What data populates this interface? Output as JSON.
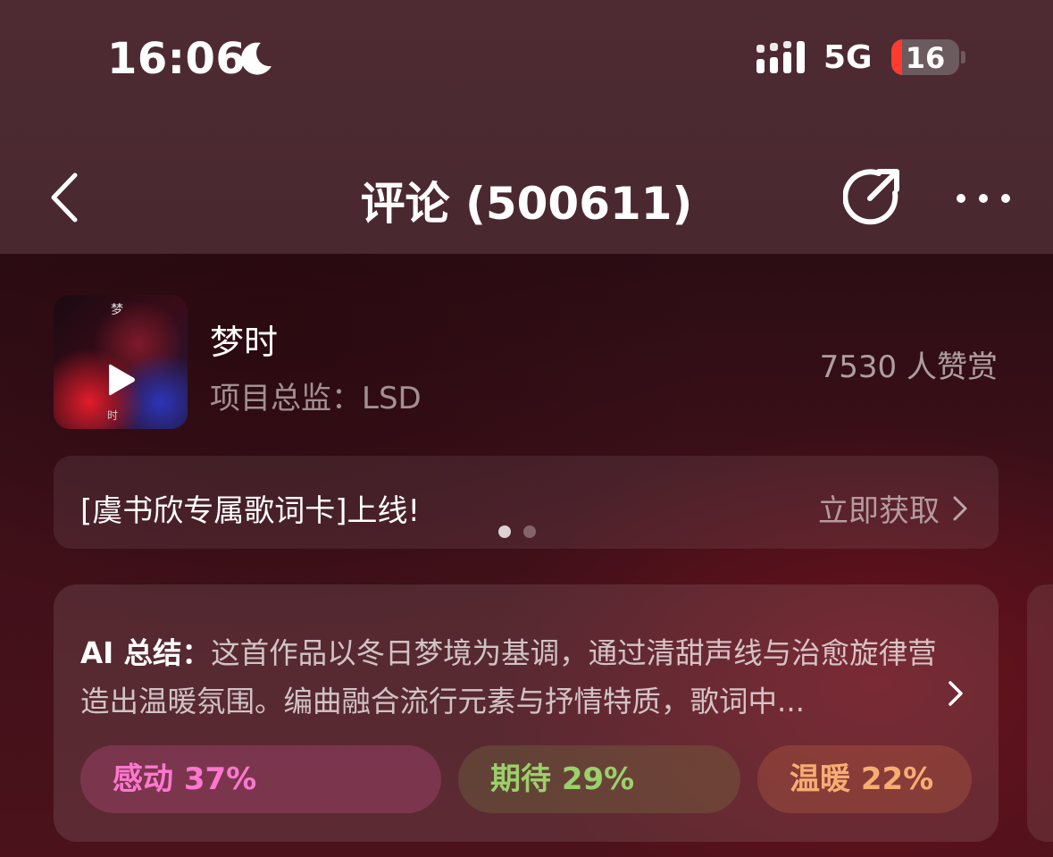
{
  "status_bar": {
    "time": "16:06",
    "network": "5G",
    "battery_level": "16",
    "battery_fraction": 0.16
  },
  "nav": {
    "title": "评论 (500611)",
    "icons": [
      "chevron-left-icon",
      "share-icon",
      "more-icon"
    ]
  },
  "song": {
    "title": "梦时",
    "subtitle": "项目总监：LSD",
    "likes": "7530 人赞赏",
    "cover_glyph_top": "梦",
    "cover_glyph_bottom": "时"
  },
  "banner": {
    "text": "[虞书欣专属歌词卡]上线!",
    "link": "立即获取",
    "pages": 2,
    "active_page": 1
  },
  "ai_summary": {
    "label": "AI 总结：",
    "text": "这首作品以冬日梦境为基调，通过清甜声线与治愈旋律营造出温暖氛围。编曲融合流行元素与抒情特质，歌词中...",
    "tags": [
      {
        "label": "感动 37%",
        "color": "#ff77cf"
      },
      {
        "label": "期待 29%",
        "color": "#9bd06b"
      },
      {
        "label": "温暖 22%",
        "color": "#f7ad72"
      }
    ]
  },
  "colors": {
    "battery_low": "#ff3b30",
    "background_top": "#4e2b33",
    "background_content": "#3f1019"
  }
}
